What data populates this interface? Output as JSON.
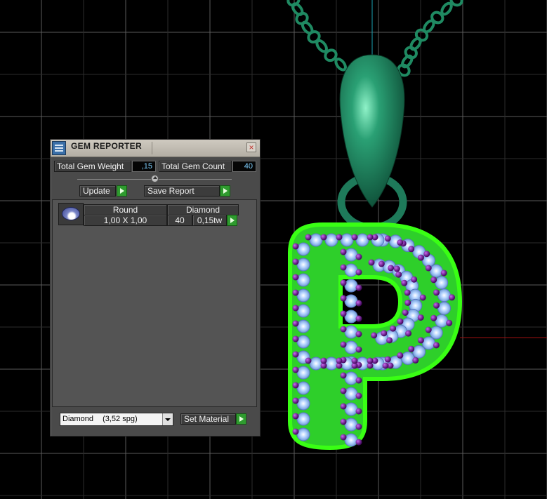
{
  "window": {
    "title": "GEM REPORTER",
    "close_glyph": "×"
  },
  "summary": {
    "weight_label": "Total Gem Weight",
    "weight_value": ",15",
    "count_label": "Total Gem Count",
    "count_value": "40"
  },
  "actions": {
    "update_label": "Update",
    "save_report_label": "Save Report"
  },
  "gem_list": [
    {
      "shape": "Round",
      "material": "Diamond",
      "size": "1,00 X 1,00",
      "count": "40",
      "weight": "0,15tw"
    }
  ],
  "material_select": {
    "name": "Diamond",
    "density": "(3,52 spg)"
  },
  "set_material_label": "Set Material",
  "colors": {
    "viewport_bg": "#000000",
    "grid": "#5a5a5a",
    "chain_metal": "#1f7a5a",
    "pendant_glow": "#39ff14",
    "prong_purple": "#7a1aa0",
    "gem_blue": "#9cc8ff",
    "axis_red": "#b01010",
    "axis_cyan": "#1aa0b0"
  },
  "icons": {
    "title_icon": "gem-reporter-icon",
    "gem_thumb": "round-gem-icon",
    "close": "close-icon",
    "play": "play-arrow-icon",
    "dropdown": "chevron-down-icon"
  }
}
